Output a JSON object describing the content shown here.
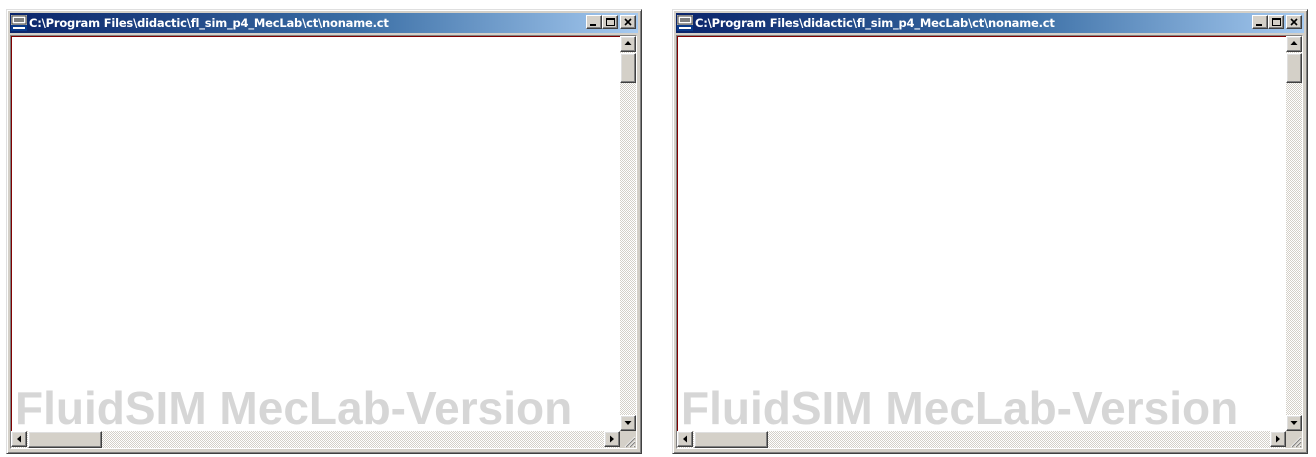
{
  "windows": [
    {
      "title": "C:\\Program Files\\didactic\\fl_sim_p4_MecLab\\ct\\noname.ct",
      "watermark": "FluidSIM MecLab-Version",
      "vertical_scroll_fraction": 0.0,
      "horizontal_scroll_fraction": 0.0
    },
    {
      "title": "C:\\Program Files\\didactic\\fl_sim_p4_MecLab\\ct\\noname.ct",
      "watermark": "FluidSIM MecLab-Version",
      "vertical_scroll_fraction": 0.0,
      "horizontal_scroll_fraction": 0.0
    }
  ],
  "colors": {
    "title_gradient_start": "#0a246a",
    "title_gradient_end": "#a6caf0",
    "watermark": "#d6d6d6",
    "canvas_border": "#800000"
  },
  "icons": {
    "app": "festo-app-icon",
    "minimize": "minimize-icon",
    "maximize": "maximize-icon",
    "close": "close-icon",
    "scroll_up": "arrow-up-icon",
    "scroll_down": "arrow-down-icon",
    "scroll_left": "arrow-left-icon",
    "scroll_right": "arrow-right-icon",
    "grip": "size-grip-icon"
  }
}
